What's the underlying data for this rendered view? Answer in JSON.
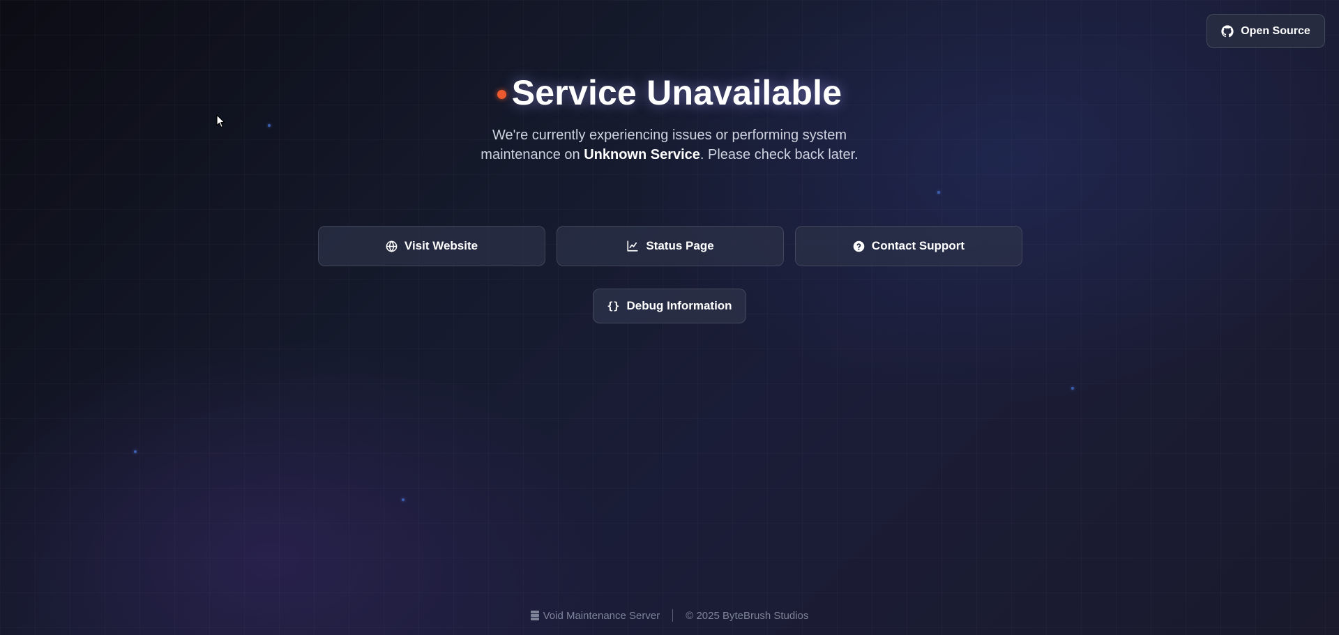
{
  "header": {
    "open_source_label": "Open Source",
    "open_source_icon": "github-icon"
  },
  "hero": {
    "title": "Service Unavailable",
    "status_color": "#ee5a2e",
    "subtitle_before": "We're currently experiencing issues or performing system maintenance on ",
    "service_name": "Unknown Service",
    "subtitle_after": ". Please check back later."
  },
  "actions": [
    {
      "label": "Visit Website",
      "icon": "globe-icon"
    },
    {
      "label": "Status Page",
      "icon": "chart-line-icon"
    },
    {
      "label": "Contact Support",
      "icon": "question-circle-icon"
    }
  ],
  "debug": {
    "label": "Debug Information",
    "icon_text": "{}"
  },
  "footer": {
    "server_label": "Void Maintenance Server",
    "server_icon": "server-icon",
    "copyright": "© 2025 ByteBrush Studios"
  },
  "colors": {
    "accent_dot": "#ee5a2e",
    "star": "#3c5fb0"
  }
}
